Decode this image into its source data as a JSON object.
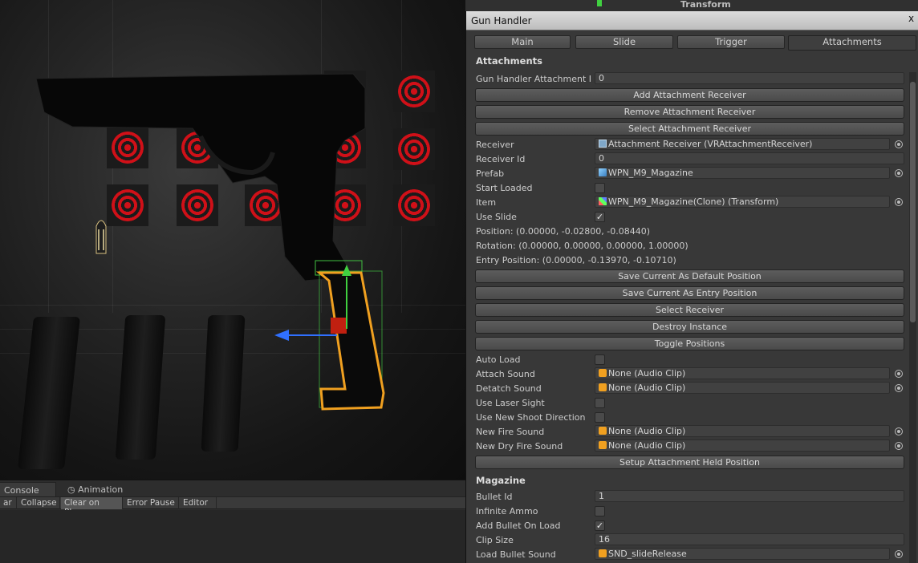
{
  "inspector": {
    "title": "Gun Handler",
    "close_glyph": "x",
    "tabs": [
      "Main",
      "Slide",
      "Trigger",
      "Attachments"
    ],
    "active_tab": "Attachments",
    "attachments_header": "Attachments",
    "gun_handler_attachment_label": "Gun Handler Attachment I",
    "gun_handler_attachment_value": "0",
    "buttons": {
      "add_receiver": "Add Attachment Receiver",
      "remove_receiver": "Remove Attachment Receiver",
      "select_receiver_top": "Select Attachment Receiver",
      "save_default": "Save Current As Default Position",
      "save_entry": "Save Current As Entry Position",
      "select_receiver": "Select Receiver",
      "destroy_instance": "Destroy Instance",
      "toggle_positions": "Toggle Positions",
      "setup_held": "Setup Attachment Held Position"
    },
    "fields": {
      "receiver_label": "Receiver",
      "receiver_value": "Attachment Receiver (VRAttachmentReceiver)",
      "receiver_id_label": "Receiver Id",
      "receiver_id_value": "0",
      "prefab_label": "Prefab",
      "prefab_value": "WPN_M9_Magazine",
      "start_loaded_label": "Start Loaded",
      "item_label": "Item",
      "item_value": "WPN_M9_Magazine(Clone) (Transform)",
      "use_slide_label": "Use Slide",
      "position_text": "Position: (0.00000, -0.02800, -0.08440)",
      "rotation_text": "Rotation: (0.00000, 0.00000, 0.00000, 1.00000)",
      "entry_position_text": "Entry Position: (0.00000, -0.13970, -0.10710)",
      "auto_load_label": "Auto Load",
      "attach_sound_label": "Attach Sound",
      "attach_sound_value": "None (Audio Clip)",
      "detatch_sound_label": "Detatch Sound",
      "detatch_sound_value": "None (Audio Clip)",
      "use_laser_sight_label": "Use Laser Sight",
      "use_new_shoot_direction_label": "Use New Shoot Direction",
      "new_fire_sound_label": "New Fire Sound",
      "new_fire_sound_value": "None (Audio Clip)",
      "new_dry_fire_sound_label": "New Dry Fire Sound",
      "new_dry_fire_sound_value": "None (Audio Clip)"
    },
    "checkboxes": {
      "start_loaded": "",
      "use_slide": "✓",
      "auto_load": "",
      "use_laser_sight": "",
      "use_new_shoot_direction": "",
      "infinite_ammo": "",
      "add_bullet_on_load": "✓"
    },
    "magazine_header": "Magazine",
    "magazine": {
      "bullet_id_label": "Bullet Id",
      "bullet_id_value": "1",
      "infinite_ammo_label": "Infinite Ammo",
      "add_bullet_on_load_label": "Add Bullet On Load",
      "clip_size_label": "Clip Size",
      "clip_size_value": "16",
      "load_bullet_sound_label": "Load Bullet Sound",
      "load_bullet_sound_value": "SND_slideRelease"
    }
  },
  "top_strip": {
    "transform_label": "Transform"
  },
  "console": {
    "tabs": [
      "Console",
      "Animation"
    ],
    "toolbar": [
      "ar",
      "Collapse",
      "Clear on Play",
      "Error Pause",
      "Editor"
    ],
    "editor_dropdown_glyph": "▾"
  },
  "colors": {
    "target_red": "#d01018",
    "selection_orange": "#f0a020",
    "gizmo_green": "#40d040",
    "gizmo_blue": "#3070ff"
  }
}
